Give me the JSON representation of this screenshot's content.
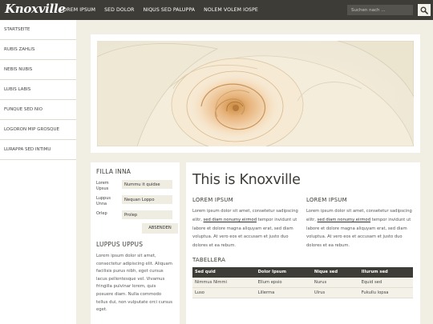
{
  "header": {
    "logo": "Knoxville",
    "nav": [
      "LOREM IPSUM",
      "SED DOLOR",
      "NIQUS SED PALUPPA",
      "NOLEM VOLEM IOSPE"
    ],
    "search_placeholder": "Suchen nach ...",
    "search_icon": "search-icon"
  },
  "sidebar": {
    "items": [
      "STARTSEITE",
      "RUBIS ZAHLIS",
      "NEBIS NUBIS",
      "LUBIS LABIS",
      "FUNQUE SED NIO",
      "LOGORON MIP GROSQUE",
      "LURAPPA SED INTIMU"
    ]
  },
  "form": {
    "title": "FILLA INNA",
    "fields": [
      {
        "label": "Lorem Upsus",
        "value": "Nummu it quidse"
      },
      {
        "label": "Luppus Unna",
        "value": "Nequan Loppo"
      },
      {
        "label": "Orlep",
        "value": "Prolep"
      }
    ],
    "submit": "ABSENDEN"
  },
  "aside": {
    "title": "LUPPUS UPPUS",
    "text": "Lorem ipsum dolor sit amet, consectetur adipiscing elit. Aliquam facilisis purus nibh, eget cursus lacus pellentesque vel. Vivamus fringilla pulvinar lorem, quis posuere diam. Nulla commodo tellus dui, non vulputate orci cursus eget."
  },
  "main": {
    "title": "This is Knoxville",
    "columns": [
      {
        "title": "LOREM IPSUM",
        "before": "Lorem ipsum dolor sit amet, consetetur sadipscing elitr, ",
        "link": "sed diam nonumy eirmod",
        "after": " tempor invidunt ut labore et dolore magna aliquyam erat, sed diam voluptua. At vero eos et accusam et justo duo dolores et ea rebum."
      },
      {
        "title": "LOREM IPSUM",
        "before": "Lorem ipsum dolor sit amet, consetetur sadipscing elitr, ",
        "link": "sed diam nonumy eirmod",
        "after": " tempor invidunt ut labore et dolore magna aliquyam erat, sed diam voluptua. At vero eos et accusam et justo duo dolores et ea rebum."
      }
    ],
    "table_title": "TABELLERA",
    "table": {
      "headers": [
        "Sed quid",
        "Dolor Ipsum",
        "Nique sed",
        "Illurum sed"
      ],
      "rows": [
        [
          "Nimmus Nimmi",
          "Ellum epsio",
          "Nurus",
          "Equid sed"
        ],
        [
          "Luso",
          "Lillerma",
          "Ulrus",
          "Fukullu lopsa"
        ]
      ]
    }
  },
  "colors": {
    "topbar": "#3e3c37",
    "background": "#f1efe4",
    "accent": "#3e3c37"
  }
}
